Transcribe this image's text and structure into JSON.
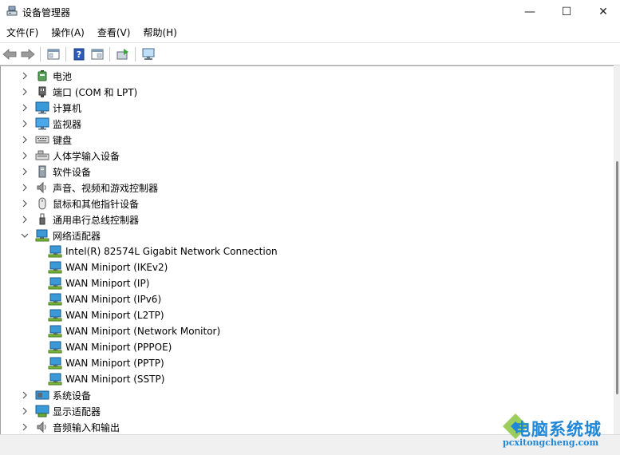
{
  "window": {
    "title": "设备管理器",
    "minimize": "—",
    "maximize": "☐",
    "close": "✕"
  },
  "menu": [
    {
      "label": "文件(F)"
    },
    {
      "label": "操作(A)"
    },
    {
      "label": "查看(V)"
    },
    {
      "label": "帮助(H)"
    }
  ],
  "toolbar": {
    "buttons": [
      "back-icon",
      "forward-icon",
      "properties-icon",
      "help-icon",
      "view-icon",
      "update-driver-icon",
      "scan-hardware-icon"
    ]
  },
  "tree": {
    "items": [
      {
        "label": "电池",
        "icon": "battery-icon",
        "expanded": false
      },
      {
        "label": "端口 (COM 和 LPT)",
        "icon": "port-icon",
        "expanded": false
      },
      {
        "label": "计算机",
        "icon": "computer-icon",
        "expanded": false
      },
      {
        "label": "监视器",
        "icon": "monitor-icon",
        "expanded": false
      },
      {
        "label": "键盘",
        "icon": "keyboard-icon",
        "expanded": false
      },
      {
        "label": "人体学输入设备",
        "icon": "hid-icon",
        "expanded": false
      },
      {
        "label": "软件设备",
        "icon": "software-device-icon",
        "expanded": false
      },
      {
        "label": "声音、视频和游戏控制器",
        "icon": "speaker-icon",
        "expanded": false
      },
      {
        "label": "鼠标和其他指针设备",
        "icon": "mouse-icon",
        "expanded": false
      },
      {
        "label": "通用串行总线控制器",
        "icon": "usb-icon",
        "expanded": false
      },
      {
        "label": "网络适配器",
        "icon": "network-icon",
        "expanded": true
      },
      {
        "label": "Intel(R) 82574L Gigabit Network Connection",
        "icon": "network-adapter-icon",
        "child": true
      },
      {
        "label": "WAN Miniport (IKEv2)",
        "icon": "network-adapter-icon",
        "child": true
      },
      {
        "label": "WAN Miniport (IP)",
        "icon": "network-adapter-icon",
        "child": true
      },
      {
        "label": "WAN Miniport (IPv6)",
        "icon": "network-adapter-icon",
        "child": true
      },
      {
        "label": "WAN Miniport (L2TP)",
        "icon": "network-adapter-icon",
        "child": true
      },
      {
        "label": "WAN Miniport (Network Monitor)",
        "icon": "network-adapter-icon",
        "child": true
      },
      {
        "label": "WAN Miniport (PPPOE)",
        "icon": "network-adapter-icon",
        "child": true
      },
      {
        "label": "WAN Miniport (PPTP)",
        "icon": "network-adapter-icon",
        "child": true
      },
      {
        "label": "WAN Miniport (SSTP)",
        "icon": "network-adapter-icon",
        "child": true
      },
      {
        "label": "系统设备",
        "icon": "system-device-icon",
        "expanded": false
      },
      {
        "label": "显示适配器",
        "icon": "display-adapter-icon",
        "expanded": false
      },
      {
        "label": "音频输入和输出",
        "icon": "audio-io-icon",
        "expanded": false
      }
    ]
  },
  "watermark": {
    "title": "电脑系统城",
    "url": "pcxitongcheng.com"
  },
  "colors": {
    "accent": "#1f86d8",
    "network": "#2f7fd0"
  }
}
